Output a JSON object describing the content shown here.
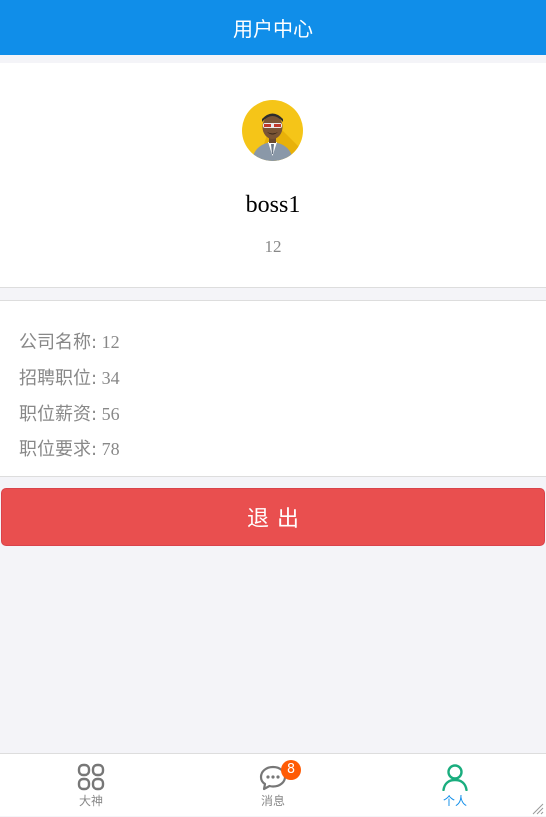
{
  "header": {
    "title": "用户中心"
  },
  "profile": {
    "username": "boss1",
    "company": "12",
    "avatar_icon": "boss-avatar-icon"
  },
  "info": {
    "rows": [
      {
        "label": "公司名称:",
        "value": "12"
      },
      {
        "label": "招聘职位:",
        "value": "34"
      },
      {
        "label": "职位薪资:",
        "value": "56"
      },
      {
        "label": "职位要求:",
        "value": "78"
      }
    ]
  },
  "logout": {
    "label": "退出"
  },
  "tabbar": {
    "tabs": [
      {
        "label": "大神",
        "icon": "grid-icon",
        "active": false
      },
      {
        "label": "消息",
        "icon": "message-icon",
        "active": false,
        "badge": "8"
      },
      {
        "label": "个人",
        "icon": "user-icon",
        "active": true
      }
    ]
  },
  "colors": {
    "header_bg": "#108ee9",
    "logout_bg": "#e94f4f",
    "badge_bg": "#ff5b05",
    "active_tab": "#108ee9"
  }
}
